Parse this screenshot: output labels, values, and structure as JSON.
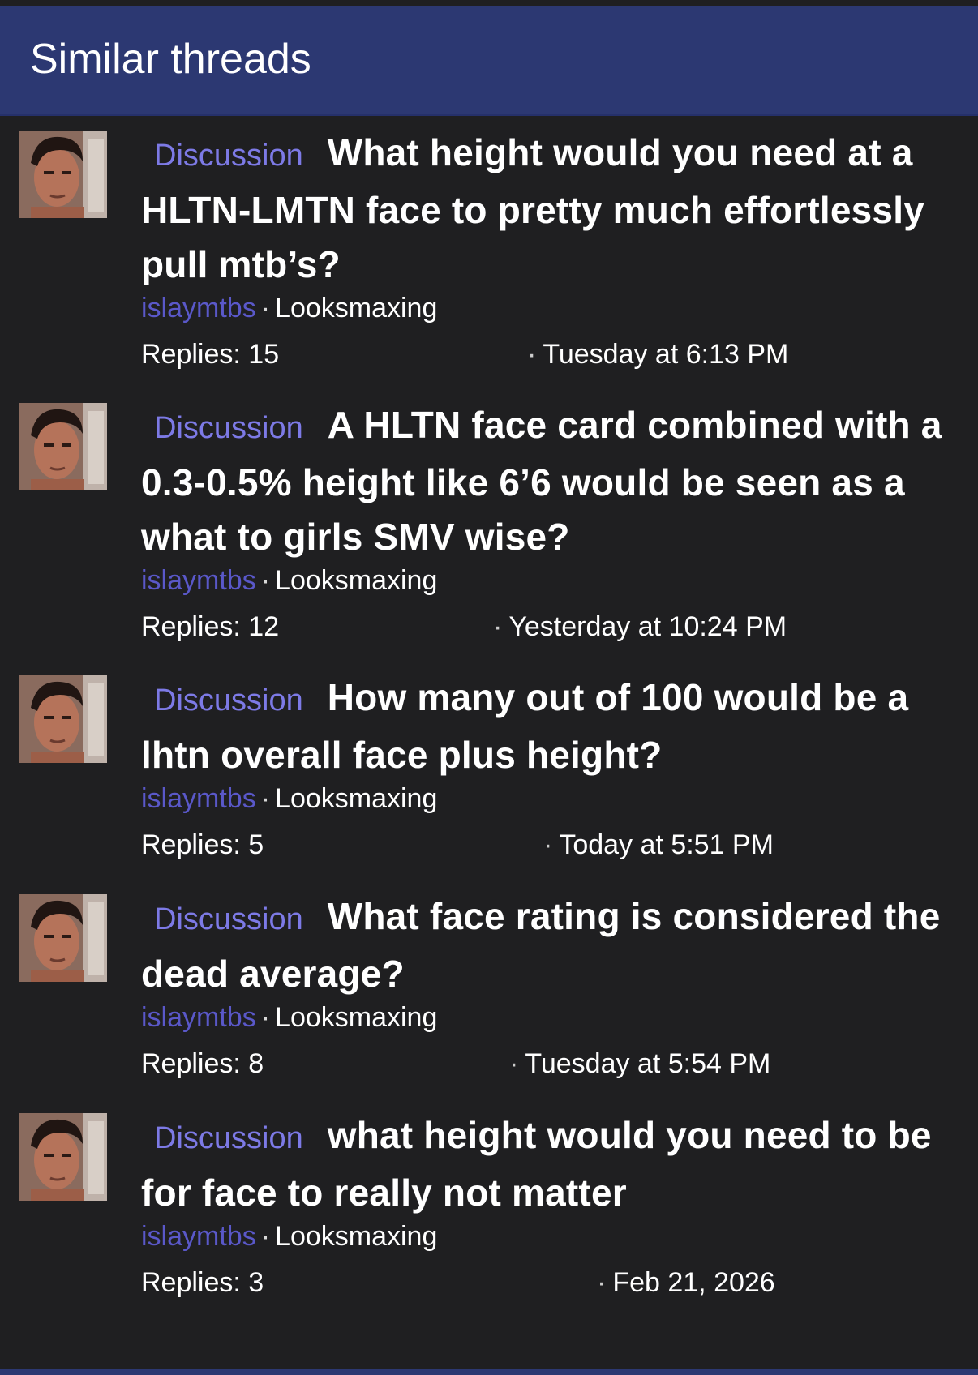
{
  "panel": {
    "title": "Similar threads"
  },
  "threads": [
    {
      "prefix": "Discussion",
      "title": "What height would you need at a HLTN-LMTN face to pretty much effortlessly pull mtb’s?",
      "author": "islaymtbs",
      "separator": "·",
      "forum": "Looksmaxing",
      "replies": "Replies: 15",
      "date_dot": "·",
      "date": "Tuesday at 6:13 PM"
    },
    {
      "prefix": "Discussion",
      "title": "A HLTN face card combined with a 0.3-0.5% height like 6’6 would be seen as a what to girls SMV wise?",
      "author": "islaymtbs",
      "separator": "·",
      "forum": "Looksmaxing",
      "replies": "Replies: 12",
      "date_dot": "·",
      "date": "Yesterday at 10:24 PM"
    },
    {
      "prefix": "Discussion",
      "title": "How many out of 100 would be a lhtn overall face plus height?",
      "author": "islaymtbs",
      "separator": "·",
      "forum": "Looksmaxing",
      "replies": "Replies: 5",
      "date_dot": "·",
      "date": "Today at 5:51 PM"
    },
    {
      "prefix": "Discussion",
      "title": "What face rating is considered the dead average?",
      "author": "islaymtbs",
      "separator": "·",
      "forum": "Looksmaxing",
      "replies": "Replies: 8",
      "date_dot": "·",
      "date": "Tuesday at 5:54 PM"
    },
    {
      "prefix": "Discussion",
      "title": "what height would you need to be for face to really not matter",
      "author": "islaymtbs",
      "separator": "·",
      "forum": "Looksmaxing",
      "replies": "Replies: 3",
      "date_dot": "·",
      "date": "Feb 21, 2026"
    }
  ],
  "colors": {
    "background": "#1f1f21",
    "header": "#2c3872",
    "prefix": "#7d7ae6",
    "author": "#5a58c9"
  }
}
